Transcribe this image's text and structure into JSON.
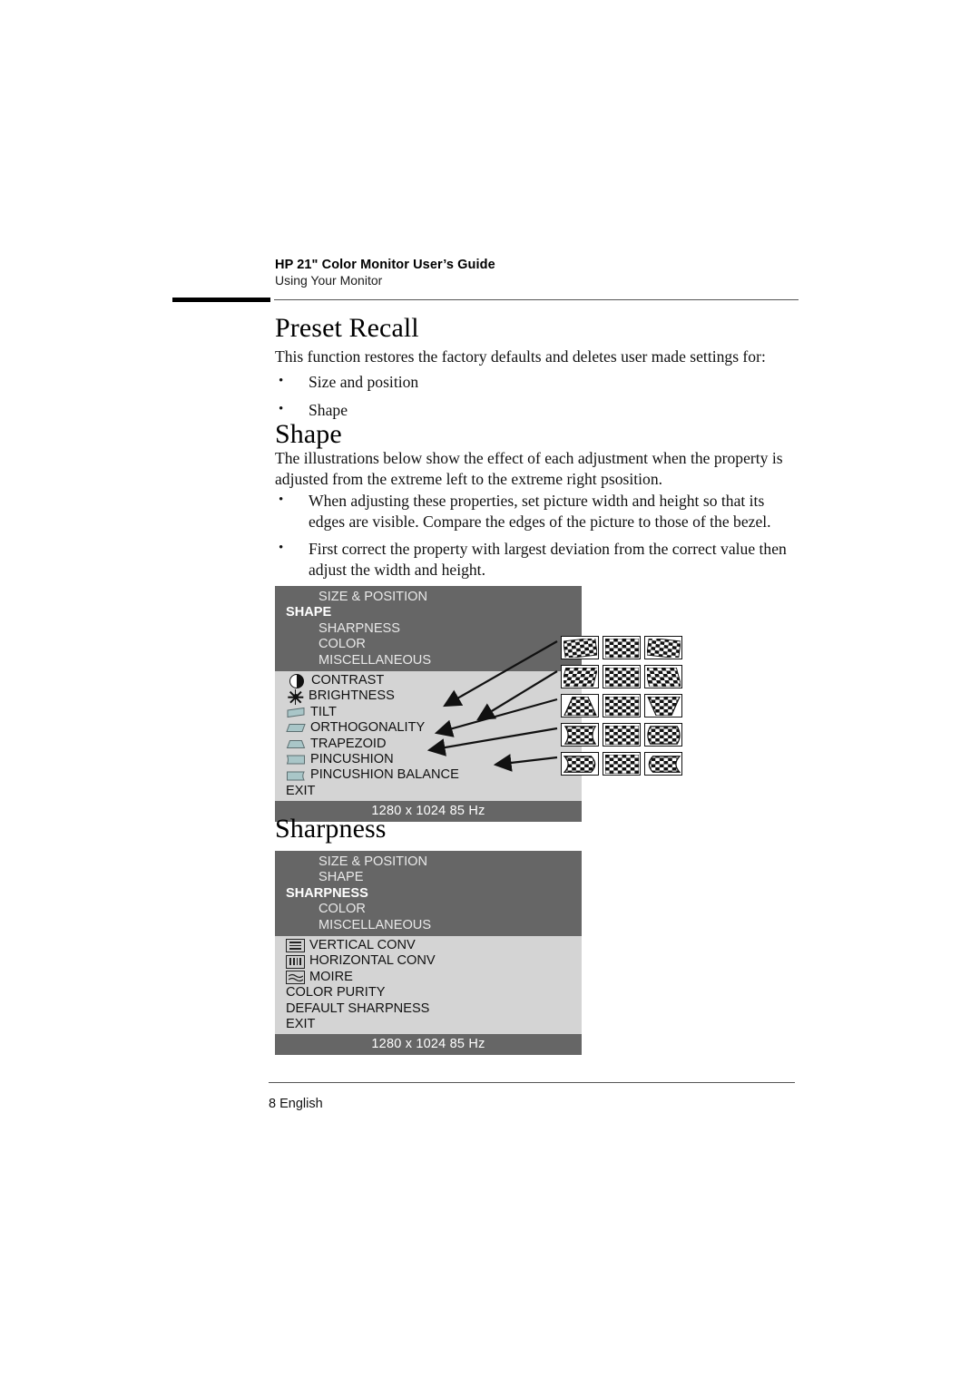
{
  "header": {
    "title": "HP 21\" Color Monitor User’s Guide",
    "subtitle": "Using Your Monitor"
  },
  "sections": [
    {
      "heading": "Preset Recall",
      "intro": "This function restores the factory defaults and deletes user made settings for:",
      "bullets": [
        "Size and position",
        "Shape"
      ]
    },
    {
      "heading": "Shape",
      "intro": "The illustrations below show the effect of each adjustment when the property is adjusted from the extreme left to the extreme right psosition.",
      "bullets": [
        "When adjusting these properties, set picture width and height so that its edges are visible. Compare the edges of the picture to those of the bezel.",
        "First correct the property with largest deviation from the correct value then adjust the width and height."
      ]
    },
    {
      "heading": "Sharpness"
    }
  ],
  "osd_shape": {
    "categories": [
      {
        "label": "SIZE & POSITION",
        "selected": false
      },
      {
        "label": "SHAPE",
        "selected": true
      },
      {
        "label": "SHARPNESS",
        "selected": false
      },
      {
        "label": "COLOR",
        "selected": false
      },
      {
        "label": "MISCELLANEOUS",
        "selected": false
      }
    ],
    "items": [
      {
        "label": "CONTRAST",
        "icon": "contrast-icon"
      },
      {
        "label": "BRIGHTNESS",
        "icon": "brightness-icon"
      },
      {
        "label": "TILT",
        "icon": "tilt-shape-icon"
      },
      {
        "label": "ORTHOGONALITY",
        "icon": "orthogonality-shape-icon"
      },
      {
        "label": "TRAPEZOID",
        "icon": "trapezoid-shape-icon"
      },
      {
        "label": "PINCUSHION",
        "icon": "pincushion-shape-icon"
      },
      {
        "label": "PINCUSHION BALANCE",
        "icon": "pincushion-balance-shape-icon"
      },
      {
        "label": "EXIT",
        "icon": "none"
      }
    ],
    "status": "1280 x 1024  85 Hz"
  },
  "thumbnails": {
    "rows": [
      {
        "name": "tilt",
        "cells": [
          "rotated-left",
          "normal",
          "rotated-right"
        ]
      },
      {
        "name": "orthogonality",
        "cells": [
          "skew-left",
          "normal",
          "skew-right"
        ]
      },
      {
        "name": "trapezoid",
        "cells": [
          "narrow-top",
          "normal",
          "narrow-bottom"
        ]
      },
      {
        "name": "pincushion",
        "cells": [
          "pinched-in",
          "normal",
          "barrel-out"
        ]
      },
      {
        "name": "pincushion-balance",
        "cells": [
          "s-curve-left",
          "normal",
          "s-curve-right"
        ]
      }
    ]
  },
  "osd_sharpness": {
    "categories": [
      {
        "label": "SIZE & POSITION",
        "selected": false
      },
      {
        "label": "SHAPE",
        "selected": false
      },
      {
        "label": "SHARPNESS",
        "selected": true
      },
      {
        "label": "COLOR",
        "selected": false
      },
      {
        "label": "MISCELLANEOUS",
        "selected": false
      }
    ],
    "items": [
      {
        "label": "VERTICAL CONV",
        "icon": "vertical-conv-icon"
      },
      {
        "label": "HORIZONTAL CONV",
        "icon": "horizontal-conv-icon"
      },
      {
        "label": "MOIRE",
        "icon": "moire-icon"
      },
      {
        "label": "COLOR PURITY",
        "icon": "none"
      },
      {
        "label": "DEFAULT SHARPNESS",
        "icon": "none"
      },
      {
        "label": "EXIT",
        "icon": "none"
      }
    ],
    "status": "1280 x 1024  85 Hz"
  },
  "footer": {
    "page": "8 English"
  },
  "colors": {
    "osd_header_bg": "#666666",
    "osd_body_bg": "#d4d4d4",
    "osd_status_bg": "#666666",
    "shape_icon_fill": "#a9c6c8"
  }
}
